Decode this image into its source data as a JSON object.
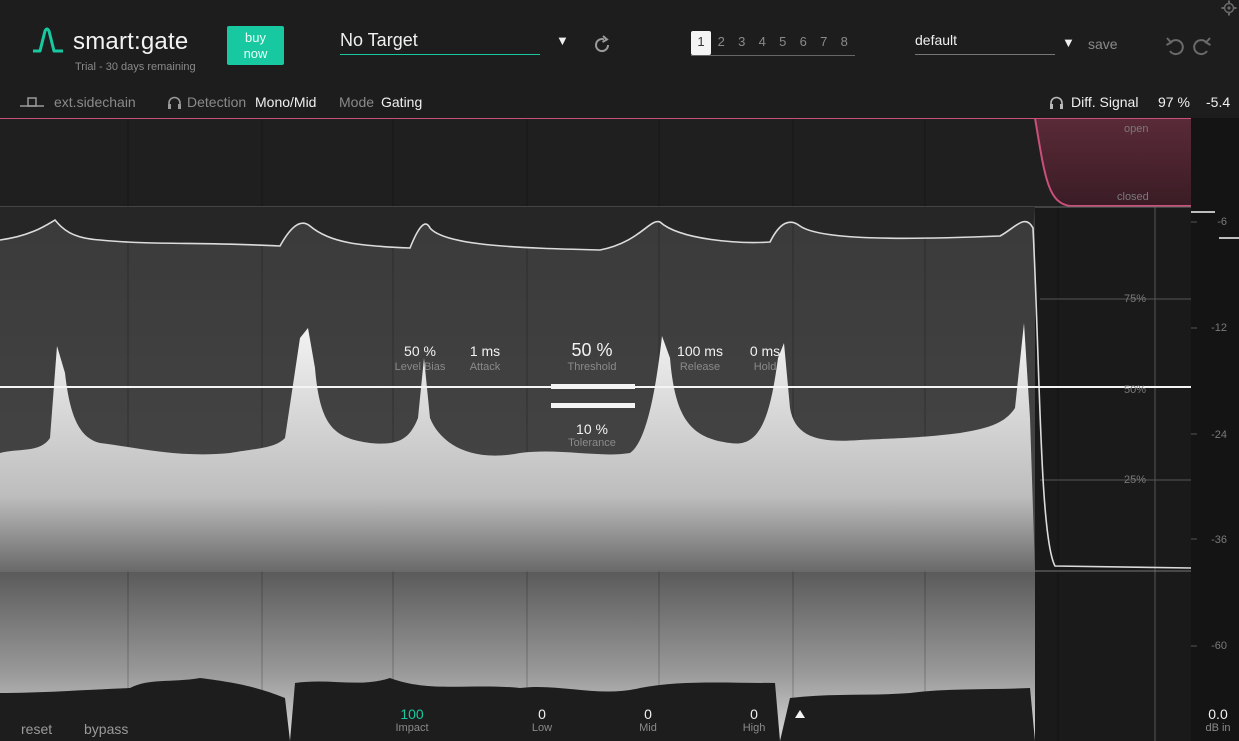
{
  "header": {
    "app_name": "smart:gate",
    "trial_text": "Trial - 30 days remaining",
    "buy_label": "buy now",
    "target_value": "No Target",
    "presets": [
      "1",
      "2",
      "3",
      "4",
      "5",
      "6",
      "7",
      "8"
    ],
    "active_preset": "1",
    "profile_value": "default",
    "save_label": "save"
  },
  "toolbar": {
    "sidechain_label": "ext.sidechain",
    "detection_label": "Detection",
    "detection_value": "Mono/Mid",
    "mode_label": "Mode",
    "mode_value": "Gating",
    "diff_signal_label": "Diff. Signal",
    "diff_signal_value": "97 %",
    "level_value": "-5.4"
  },
  "gate_display": {
    "open_label": "open",
    "closed_label": "closed"
  },
  "params": {
    "level_bias": {
      "value": "50 %",
      "label": "Level Bias"
    },
    "attack": {
      "value": "1 ms",
      "label": "Attack"
    },
    "threshold": {
      "value": "50 %",
      "label": "Threshold"
    },
    "release": {
      "value": "100 ms",
      "label": "Release"
    },
    "hold": {
      "value": "0 ms",
      "label": "Hold"
    },
    "tolerance": {
      "value": "10 %",
      "label": "Tolerance"
    }
  },
  "percent_labels": [
    "75%",
    "50%",
    "25%"
  ],
  "db_scale": [
    "-6",
    "-12",
    "-24",
    "-36",
    "-60"
  ],
  "footer": {
    "reset_label": "reset",
    "bypass_label": "bypass",
    "impact": {
      "value": "100",
      "label": "Impact"
    },
    "low": {
      "value": "0",
      "label": "Low"
    },
    "mid": {
      "value": "0",
      "label": "Mid"
    },
    "high": {
      "value": "0",
      "label": "High"
    },
    "db_in": {
      "value": "0.0",
      "label": "dB in"
    }
  },
  "colors": {
    "accent": "#18c8a0",
    "gate_curve": "#c8507a",
    "background": "#1d1d1d"
  }
}
